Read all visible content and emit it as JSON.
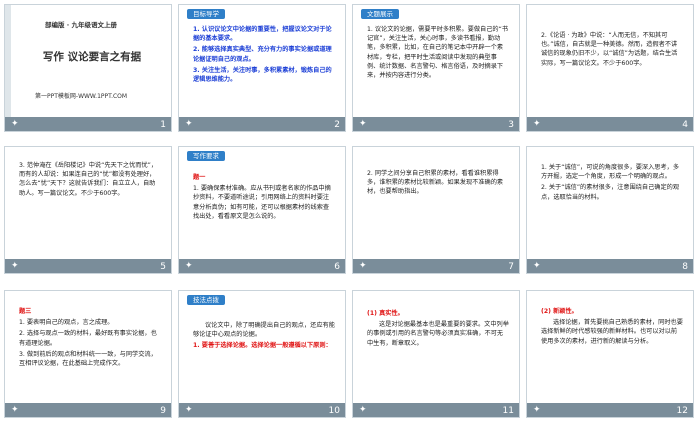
{
  "slides": [
    {
      "num": "1",
      "head": "部编版 · 九年级语文上册",
      "title": "写作 议论要言之有据",
      "source": "第一PPT模板网-WWW.1PPT.COM"
    },
    {
      "num": "2",
      "tag": "目标导学",
      "lines": [
        "1. 认识议论文中论据的重要性，把握议论文对于论据的基本要求。",
        "2. 能够选择真实典型、充分有力的事实论据或道理论据证明自己的观点。",
        "3. 关注生活，关注时事，多积累素材，锻炼自己的逻辑思维能力。"
      ]
    },
    {
      "num": "3",
      "tag": "文题展示",
      "lines": [
        "1. 议论文的论据，需要平时多积累。要做自己的“书记官”，关注生活，关心时事，多读书看报，勤动笔，多积累，比如，在自己的笔记本中开辟一个素材库，专栏，把平时生活或阅读中发现的典型事例、统计数据、名言警句、格言俗语，及时摘录下来，并按内容进行分类。"
      ]
    },
    {
      "num": "4",
      "lines": [
        "2.《论语 · 为政》中说：“人而无信，不知其可也。”诚信，自古就是一种美德。然而，造假者不讲诚信的现象仍旧不少，以“诚信”为话题，结合生活实际，写一篇议论文。不少于600字。"
      ]
    },
    {
      "num": "5",
      "lines": [
        "3. 范仲淹在《岳阳楼记》中说“先天下之忧而忧”，而有的人却说：如果连自己的“忧”都没有处理好，怎么去“忧”天下？这就告诉我们：自立立人，自助助人。写一篇议论文。不少于600字。"
      ]
    },
    {
      "num": "6",
      "tag": "写作要求",
      "lines": [
        "题一",
        "1. 要确保素材准确。应从书刊或者名家的作品中摘抄资料，不要道听途说；引用网络上的资料时要注意分析真伪；如有可能，还可以根据素材的线索查找出处，看看原文是怎么说的。"
      ]
    },
    {
      "num": "7",
      "lines": [
        "2. 同学之间分享自己积累的素材，看看谁积累得多，谁积累的素材比较新颖。如果发现不准确的素材，也要帮助指出。"
      ]
    },
    {
      "num": "8",
      "lines": [
        "1. 关于“诚信”，可说的角度很多，要深入思考，多方开掘，选定一个角度，形成一个明确的观点。",
        "2. 关于“诚信”的素材很多，注意围绕自己确定的观点，选取恰当的材料。"
      ]
    },
    {
      "num": "9",
      "lines": [
        "题三",
        "1. 要表明自己的观点，言之成理。",
        "2. 选择与观点一致的材料，最好既有事实论据，也有道理论据。",
        "3. 做到前后的观点和材料统一一致，与同学交流，互相评议论据，在此基础上完成作文。"
      ]
    },
    {
      "num": "10",
      "tag": "技法点拨",
      "lines": [
        "议论文中，除了明确提出自己的观点，还应有能够论证中心观点的论据。",
        "1. 要善于选择论据。选择论据一般遵循以下原则："
      ]
    },
    {
      "num": "11",
      "lines": [
        "(1) 真实性。",
        "这是对论据最基本也是最重要的要求。文中列举的事例或引用的名言警句等必须真实准确，不可无中生有，断章取义。"
      ]
    },
    {
      "num": "12",
      "lines": [
        "(2) 新颖性。",
        "选择论据，首先要挑自己熟悉的素材，同时也要选择新鲜的时代感较强的新鲜材料。也可以对以前使用多次的素材，进行新的解读与分析。"
      ]
    }
  ]
}
